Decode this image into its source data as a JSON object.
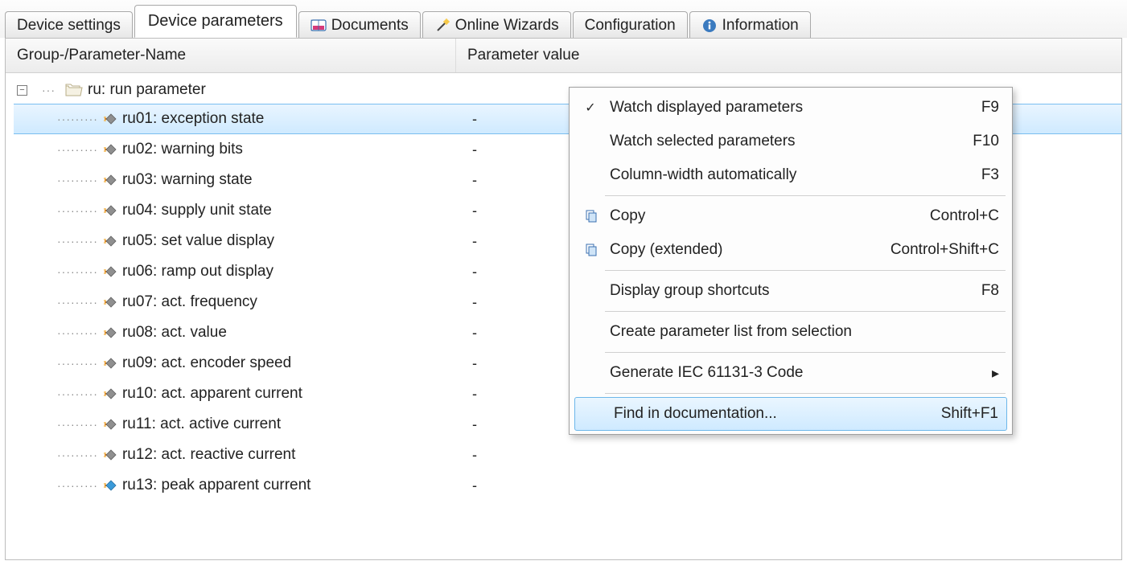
{
  "tabs": [
    {
      "label": "Device settings",
      "icon": null,
      "active": false
    },
    {
      "label": "Device parameters",
      "icon": null,
      "active": true
    },
    {
      "label": "Documents",
      "icon": "keb-icon",
      "active": false
    },
    {
      "label": "Online Wizards",
      "icon": "wand-icon",
      "active": false
    },
    {
      "label": "Configuration",
      "icon": null,
      "active": false
    },
    {
      "label": "Information",
      "icon": "info-icon",
      "active": false
    }
  ],
  "columns": {
    "name": "Group-/Parameter-Name",
    "value": "Parameter value"
  },
  "group": {
    "label": "ru: run parameter"
  },
  "parameters": [
    {
      "label": "ru01: exception state",
      "value": "-",
      "selected": true,
      "variant": "gray"
    },
    {
      "label": "ru02: warning bits",
      "value": "-",
      "selected": false,
      "variant": "gray"
    },
    {
      "label": "ru03: warning state",
      "value": "-",
      "selected": false,
      "variant": "gray"
    },
    {
      "label": "ru04: supply unit state",
      "value": "-",
      "selected": false,
      "variant": "gray"
    },
    {
      "label": "ru05: set value display",
      "value": "-",
      "selected": false,
      "variant": "gray"
    },
    {
      "label": "ru06: ramp out display",
      "value": "-",
      "selected": false,
      "variant": "gray"
    },
    {
      "label": "ru07: act. frequency",
      "value": "-",
      "selected": false,
      "variant": "gray"
    },
    {
      "label": "ru08: act. value",
      "value": "-",
      "selected": false,
      "variant": "gray"
    },
    {
      "label": "ru09: act. encoder speed",
      "value": "-",
      "selected": false,
      "variant": "gray"
    },
    {
      "label": "ru10: act. apparent current",
      "value": "-",
      "selected": false,
      "variant": "gray"
    },
    {
      "label": "ru11: act. active current",
      "value": "-",
      "selected": false,
      "variant": "gray"
    },
    {
      "label": "ru12: act. reactive current",
      "value": "-",
      "selected": false,
      "variant": "gray"
    },
    {
      "label": "ru13: peak apparent current",
      "value": "-",
      "selected": false,
      "variant": "blue"
    }
  ],
  "context_menu": {
    "items": [
      {
        "label": "Watch displayed parameters",
        "shortcut": "F9",
        "icon": "check-icon",
        "highlight": false,
        "submenu": false
      },
      {
        "label": "Watch selected parameters",
        "shortcut": "F10",
        "icon": null,
        "highlight": false,
        "submenu": false
      },
      {
        "label": "Column-width automatically",
        "shortcut": "F3",
        "icon": null,
        "highlight": false,
        "submenu": false
      },
      {
        "sep": true
      },
      {
        "label": "Copy",
        "shortcut": "Control+C",
        "icon": "copy-icon",
        "highlight": false,
        "submenu": false
      },
      {
        "label": "Copy (extended)",
        "shortcut": "Control+Shift+C",
        "icon": "copy-icon",
        "highlight": false,
        "submenu": false
      },
      {
        "sep": true
      },
      {
        "label": "Display group shortcuts",
        "shortcut": "F8",
        "icon": null,
        "highlight": false,
        "submenu": false
      },
      {
        "sep": true
      },
      {
        "label": "Create parameter list from selection",
        "shortcut": "",
        "icon": null,
        "highlight": false,
        "submenu": false
      },
      {
        "sep": true
      },
      {
        "label": "Generate IEC 61131-3 Code",
        "shortcut": "",
        "icon": null,
        "highlight": false,
        "submenu": true
      },
      {
        "sep": true
      },
      {
        "label": "Find in documentation...",
        "shortcut": "Shift+F1",
        "icon": null,
        "highlight": true,
        "submenu": false
      }
    ]
  }
}
